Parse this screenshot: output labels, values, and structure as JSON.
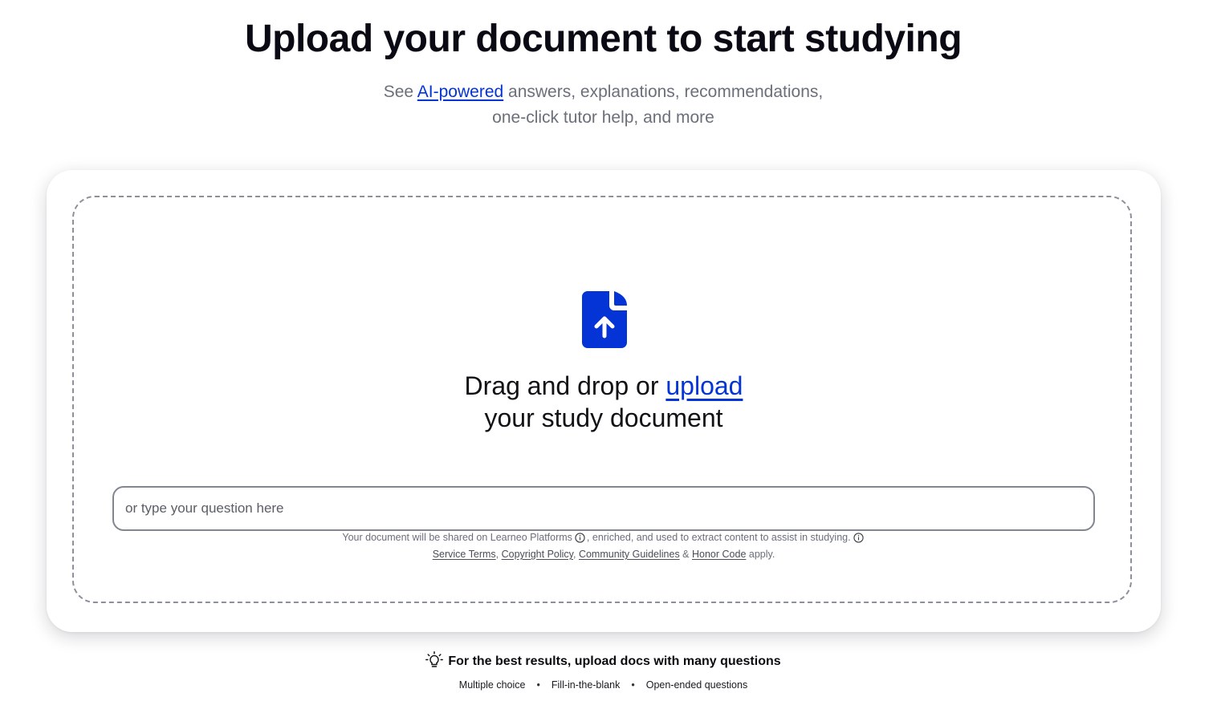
{
  "header": {
    "title": "Upload your document to start studying",
    "subtitle_prefix": "See ",
    "subtitle_link": "AI-powered",
    "subtitle_rest": " answers, explanations, recommendations,",
    "subtitle_line2": "one-click tutor help, and more"
  },
  "dropzone": {
    "icon": "document-upload-icon",
    "icon_color": "#0433d6",
    "text_prefix": "Drag and drop or ",
    "upload_link": "upload",
    "text_line2": "your study document",
    "input_placeholder": "or type your question here",
    "legal_line1_a": "Your document will be shared on Learneo Platforms",
    "legal_line1_b": ", enriched, and used to extract content to assist in studying.",
    "legal_links": {
      "service_terms": "Service Terms",
      "copyright_policy": "Copyright Policy",
      "community_guidelines": "Community Guidelines",
      "honor_code": "Honor Code"
    },
    "legal_sep_comma": ", ",
    "legal_sep_amp": " & ",
    "legal_suffix": " apply."
  },
  "tips": {
    "icon": "lightbulb-icon",
    "text": "For the best results, upload docs with many questions",
    "types": [
      "Multiple choice",
      "Fill-in-the-blank",
      "Open-ended questions"
    ],
    "separator": "•"
  },
  "colors": {
    "accent": "#0433d6",
    "muted_text": "#6b6f7a",
    "dashed_border": "#8d9099"
  }
}
